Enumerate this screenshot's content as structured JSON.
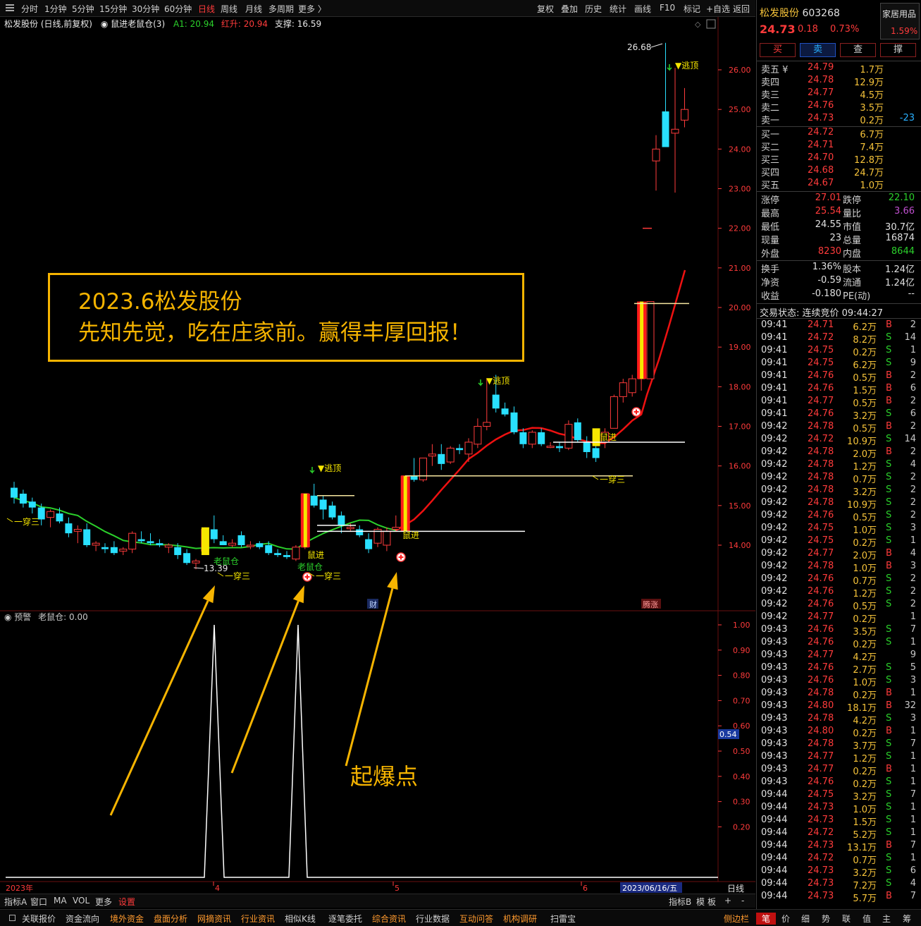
{
  "toolbar": {
    "periods": [
      "分时",
      "1分钟",
      "5分钟",
      "15分钟",
      "30分钟",
      "60分钟",
      "日线",
      "周线",
      "月线",
      "多周期",
      "更多 〉"
    ],
    "active_period": "日线",
    "tools": [
      "复权",
      "叠加",
      "历史",
      "统计",
      "画线",
      "F10",
      "标记",
      "+自选",
      "返回"
    ]
  },
  "chart_header": {
    "title": "松发股份 (日线,前复权)",
    "indicator": "鼠进老鼠仓(3)",
    "a1": "A1: 20.94",
    "hongsheng": "红升: 20.94",
    "support": "支撑: 16.59"
  },
  "annotation": {
    "line1": "2023.6松发股份",
    "line2": "先知先觉，吃在庄家前。赢得丰厚回报！",
    "boom": "起爆点"
  },
  "price_axis": [
    "26.00",
    "25.00",
    "24.00",
    "23.00",
    "22.00",
    "21.00",
    "20.00",
    "19.00",
    "18.00",
    "17.00",
    "16.00",
    "15.00",
    "14.00"
  ],
  "indicator_axis": [
    "1.00",
    "0.90",
    "0.80",
    "0.70",
    "0.60",
    "0.50",
    "0.40",
    "0.30",
    "0.20"
  ],
  "indicator_current": "0.54",
  "indicator_header": {
    "name": "预警",
    "value": "老鼠仓: 0.00"
  },
  "chart_labels": {
    "high": "26.68",
    "low": "13.39",
    "escape_top": "▼逃顶",
    "yichuansan": "一穿三",
    "laoshucang": "老鼠仓",
    "shujin": "鼠进",
    "cai": "财",
    "tengzhang": "腾涨"
  },
  "date_axis": {
    "year": "2023年",
    "months": [
      "4",
      "5",
      "6"
    ],
    "current_date": "2023/06/16/五",
    "period": "日线"
  },
  "bottom_tabs": {
    "left": [
      "指标A",
      "窗口",
      "MA",
      "VOL",
      "更多",
      "设置"
    ],
    "right": [
      "指标B",
      "模",
      "板",
      "+",
      "-"
    ]
  },
  "bottom_links": [
    "关联报价",
    "资金流向",
    "境外资金",
    "盘面分析",
    "网摘资讯",
    "行业资讯",
    "相似K线",
    "逐笔委托",
    "综合资讯",
    "行业数据",
    "互动问答",
    "机构调研",
    "扫雷宝",
    "侧边栏"
  ],
  "right_bottom_tabs": [
    "笔",
    "价",
    "细",
    "势",
    "联",
    "值",
    "主",
    "筹"
  ],
  "quote": {
    "name": "松发股份",
    "code": "603268",
    "price": "24.73",
    "change": "0.18",
    "pct": "0.73%",
    "sector_name": "家居用品",
    "sector_pct": "1.59%",
    "buttons": [
      "买",
      "卖",
      "查",
      "撑"
    ],
    "asks": [
      {
        "label": "卖五 ¥",
        "price": "24.79",
        "vol": "1.7万",
        "diff": ""
      },
      {
        "label": "卖四",
        "price": "24.78",
        "vol": "12.9万",
        "diff": ""
      },
      {
        "label": "卖三",
        "price": "24.77",
        "vol": "4.5万",
        "diff": ""
      },
      {
        "label": "卖二",
        "price": "24.76",
        "vol": "3.5万",
        "diff": ""
      },
      {
        "label": "卖一",
        "price": "24.73",
        "vol": "0.2万",
        "diff": "-23"
      }
    ],
    "bids": [
      {
        "label": "买一",
        "price": "24.72",
        "vol": "6.7万"
      },
      {
        "label": "买二",
        "price": "24.71",
        "vol": "7.4万"
      },
      {
        "label": "买三",
        "price": "24.70",
        "vol": "12.8万"
      },
      {
        "label": "买四",
        "price": "24.68",
        "vol": "24.7万"
      },
      {
        "label": "买五",
        "price": "24.67",
        "vol": "1.0万"
      }
    ],
    "stats": [
      {
        "k1": "涨停",
        "v1": "27.01",
        "c1": "#ff3b3b",
        "k2": "跌停",
        "v2": "22.10",
        "c2": "#2bd02b"
      },
      {
        "k1": "最高",
        "v1": "25.54",
        "c1": "#ff3b3b",
        "k2": "量比",
        "v2": "3.66",
        "c2": "#c050d0"
      },
      {
        "k1": "最低",
        "v1": "24.55",
        "c1": "#e0e0e0",
        "k2": "市值",
        "v2": "30.7亿",
        "c2": "#e0e0e0"
      },
      {
        "k1": "现量",
        "v1": "23",
        "c1": "#e0e0e0",
        "k2": "总量",
        "v2": "16874",
        "c2": "#e0e0e0"
      },
      {
        "k1": "外盘",
        "v1": "8230",
        "c1": "#ff3b3b",
        "k2": "内盘",
        "v2": "8644",
        "c2": "#2bd02b"
      },
      {
        "k1": "换手",
        "v1": "1.36%",
        "c1": "#e0e0e0",
        "k2": "股本",
        "v2": "1.24亿",
        "c2": "#e0e0e0"
      },
      {
        "k1": "净资",
        "v1": "-0.59",
        "c1": "#e0e0e0",
        "k2": "流通",
        "v2": "1.24亿",
        "c2": "#e0e0e0"
      },
      {
        "k1": "收益",
        "v1": "-0.180",
        "c1": "#e0e0e0",
        "k2": "PE(动)",
        "v2": "--",
        "c2": "#e0e0e0"
      }
    ],
    "trade_status": "交易状态: 连续竞价 09:44:27",
    "ticks": [
      [
        "09:41",
        "24.71",
        "6.2万",
        "B",
        "2"
      ],
      [
        "09:41",
        "24.72",
        "8.2万",
        "S",
        "14"
      ],
      [
        "09:41",
        "24.75",
        "0.2万",
        "S",
        "1"
      ],
      [
        "09:41",
        "24.75",
        "6.2万",
        "S",
        "9"
      ],
      [
        "09:41",
        "24.76",
        "0.5万",
        "B",
        "2"
      ],
      [
        "09:41",
        "24.76",
        "1.5万",
        "B",
        "6"
      ],
      [
        "09:41",
        "24.77",
        "0.5万",
        "B",
        "2"
      ],
      [
        "09:41",
        "24.76",
        "3.2万",
        "S",
        "6"
      ],
      [
        "09:42",
        "24.78",
        "0.5万",
        "B",
        "2"
      ],
      [
        "09:42",
        "24.72",
        "10.9万",
        "S",
        "14"
      ],
      [
        "09:42",
        "24.78",
        "2.0万",
        "B",
        "2"
      ],
      [
        "09:42",
        "24.78",
        "1.2万",
        "S",
        "4"
      ],
      [
        "09:42",
        "24.78",
        "0.7万",
        "S",
        "2"
      ],
      [
        "09:42",
        "24.78",
        "3.2万",
        "S",
        "2"
      ],
      [
        "09:42",
        "24.78",
        "10.9万",
        "S",
        "2"
      ],
      [
        "09:42",
        "24.76",
        "0.5万",
        "S",
        "2"
      ],
      [
        "09:42",
        "24.75",
        "1.0万",
        "S",
        "3"
      ],
      [
        "09:42",
        "24.75",
        "0.2万",
        "S",
        "1"
      ],
      [
        "09:42",
        "24.77",
        "2.0万",
        "B",
        "4"
      ],
      [
        "09:42",
        "24.78",
        "1.0万",
        "B",
        "3"
      ],
      [
        "09:42",
        "24.76",
        "0.7万",
        "S",
        "2"
      ],
      [
        "09:42",
        "24.76",
        "1.2万",
        "S",
        "2"
      ],
      [
        "09:42",
        "24.76",
        "0.5万",
        "S",
        "2"
      ],
      [
        "09:42",
        "24.77",
        "0.2万",
        "",
        "1"
      ],
      [
        "09:43",
        "24.76",
        "3.5万",
        "S",
        "7"
      ],
      [
        "09:43",
        "24.76",
        "0.2万",
        "S",
        "1"
      ],
      [
        "09:43",
        "24.77",
        "4.2万",
        "",
        "9"
      ],
      [
        "09:43",
        "24.76",
        "2.7万",
        "S",
        "5"
      ],
      [
        "09:43",
        "24.76",
        "1.0万",
        "S",
        "3"
      ],
      [
        "09:43",
        "24.78",
        "0.2万",
        "B",
        "1"
      ],
      [
        "09:43",
        "24.80",
        "18.1万",
        "B",
        "32"
      ],
      [
        "09:43",
        "24.78",
        "4.2万",
        "S",
        "3"
      ],
      [
        "09:43",
        "24.80",
        "0.2万",
        "B",
        "1"
      ],
      [
        "09:43",
        "24.78",
        "3.7万",
        "S",
        "7"
      ],
      [
        "09:43",
        "24.77",
        "1.2万",
        "S",
        "1"
      ],
      [
        "09:43",
        "24.77",
        "0.2万",
        "B",
        "1"
      ],
      [
        "09:43",
        "24.76",
        "0.2万",
        "S",
        "1"
      ],
      [
        "09:44",
        "24.75",
        "3.2万",
        "S",
        "7"
      ],
      [
        "09:44",
        "24.73",
        "1.0万",
        "S",
        "1"
      ],
      [
        "09:44",
        "24.73",
        "1.5万",
        "S",
        "1"
      ],
      [
        "09:44",
        "24.72",
        "5.2万",
        "S",
        "1"
      ],
      [
        "09:44",
        "24.73",
        "13.1万",
        "B",
        "7"
      ],
      [
        "09:44",
        "24.72",
        "0.7万",
        "S",
        "1"
      ],
      [
        "09:44",
        "24.73",
        "3.2万",
        "S",
        "6"
      ],
      [
        "09:44",
        "24.73",
        "7.2万",
        "S",
        "4"
      ],
      [
        "09:44",
        "24.73",
        "5.7万",
        "B",
        "7"
      ]
    ]
  },
  "colors": {
    "up": "#ff3b3b",
    "down": "#29e0ff",
    "ma_green": "#2bd02b",
    "ma_red": "#ee1111",
    "accent": "#f6b400",
    "laoshucang_bar": "#f6e600"
  },
  "chart_data": {
    "type": "candlestick",
    "price_range": [
      13.2,
      26.9
    ],
    "candles": [
      {
        "o": 15.45,
        "h": 15.6,
        "l": 15.05,
        "c": 15.2
      },
      {
        "o": 15.3,
        "h": 15.4,
        "l": 14.95,
        "c": 15.05
      },
      {
        "o": 15.1,
        "h": 15.2,
        "l": 14.8,
        "c": 14.95
      },
      {
        "o": 14.95,
        "h": 15.05,
        "l": 14.5,
        "c": 14.65
      },
      {
        "o": 14.7,
        "h": 14.9,
        "l": 14.45,
        "c": 14.85
      },
      {
        "o": 14.8,
        "h": 14.95,
        "l": 14.55,
        "c": 14.6
      },
      {
        "o": 14.55,
        "h": 14.7,
        "l": 14.2,
        "c": 14.3
      },
      {
        "o": 14.35,
        "h": 14.5,
        "l": 14.05,
        "c": 14.4
      },
      {
        "o": 14.4,
        "h": 14.55,
        "l": 13.95,
        "c": 14.0
      },
      {
        "o": 14.0,
        "h": 14.1,
        "l": 13.85,
        "c": 14.05
      },
      {
        "o": 13.95,
        "h": 14.05,
        "l": 13.8,
        "c": 13.9
      },
      {
        "o": 13.95,
        "h": 14.1,
        "l": 13.75,
        "c": 13.8
      },
      {
        "o": 13.85,
        "h": 13.95,
        "l": 13.75,
        "c": 13.9
      },
      {
        "o": 13.9,
        "h": 14.35,
        "l": 13.8,
        "c": 14.3
      },
      {
        "o": 14.15,
        "h": 14.35,
        "l": 14.05,
        "c": 14.1
      },
      {
        "o": 14.1,
        "h": 14.3,
        "l": 14.0,
        "c": 14.05
      },
      {
        "o": 14.05,
        "h": 14.15,
        "l": 13.95,
        "c": 14.0
      },
      {
        "o": 13.95,
        "h": 14.05,
        "l": 13.8,
        "c": 14.0
      },
      {
        "o": 13.95,
        "h": 14.05,
        "l": 13.65,
        "c": 13.75
      },
      {
        "o": 13.8,
        "h": 13.9,
        "l": 13.5,
        "c": 13.55
      },
      {
        "o": 13.55,
        "h": 13.65,
        "l": 13.39,
        "c": 13.6
      },
      {
        "o": 13.85,
        "h": 14.45,
        "l": 13.8,
        "c": 14.4
      },
      {
        "o": 14.4,
        "h": 14.75,
        "l": 14.05,
        "c": 14.15
      },
      {
        "o": 14.1,
        "h": 14.25,
        "l": 14.0,
        "c": 14.0
      },
      {
        "o": 14.0,
        "h": 14.15,
        "l": 13.95,
        "c": 14.05
      },
      {
        "o": 14.25,
        "h": 14.35,
        "l": 13.95,
        "c": 14.0
      },
      {
        "o": 14.0,
        "h": 14.1,
        "l": 13.9,
        "c": 14.0
      },
      {
        "o": 14.05,
        "h": 14.1,
        "l": 13.9,
        "c": 13.95
      },
      {
        "o": 14.0,
        "h": 14.1,
        "l": 13.75,
        "c": 13.8
      },
      {
        "o": 13.8,
        "h": 13.9,
        "l": 13.7,
        "c": 13.75
      },
      {
        "o": 13.75,
        "h": 13.85,
        "l": 13.65,
        "c": 13.7
      },
      {
        "o": 13.65,
        "h": 14.0,
        "l": 13.6,
        "c": 13.95
      },
      {
        "o": 13.95,
        "h": 15.3,
        "l": 13.9,
        "c": 15.3
      },
      {
        "o": 15.25,
        "h": 15.55,
        "l": 14.95,
        "c": 15.0
      },
      {
        "o": 15.15,
        "h": 15.25,
        "l": 14.65,
        "c": 14.9
      },
      {
        "o": 15.0,
        "h": 15.1,
        "l": 14.65,
        "c": 14.7
      },
      {
        "o": 14.75,
        "h": 14.85,
        "l": 14.3,
        "c": 14.5
      },
      {
        "o": 14.45,
        "h": 14.55,
        "l": 14.35,
        "c": 14.45
      },
      {
        "o": 14.4,
        "h": 14.5,
        "l": 14.2,
        "c": 14.25
      },
      {
        "o": 14.15,
        "h": 14.3,
        "l": 13.8,
        "c": 13.9
      },
      {
        "o": 14.05,
        "h": 14.45,
        "l": 13.95,
        "c": 14.4
      },
      {
        "o": 14.0,
        "h": 14.45,
        "l": 13.85,
        "c": 14.35
      },
      {
        "o": 14.4,
        "h": 14.75,
        "l": 14.35,
        "c": 14.45
      },
      {
        "o": 14.35,
        "h": 15.75,
        "l": 14.35,
        "c": 15.75
      },
      {
        "o": 15.75,
        "h": 16.2,
        "l": 15.6,
        "c": 15.65
      },
      {
        "o": 15.65,
        "h": 16.2,
        "l": 15.6,
        "c": 16.2
      },
      {
        "o": 16.25,
        "h": 16.55,
        "l": 16.0,
        "c": 16.3
      },
      {
        "o": 16.3,
        "h": 16.55,
        "l": 15.9,
        "c": 16.05
      },
      {
        "o": 16.1,
        "h": 16.5,
        "l": 16.05,
        "c": 16.45
      },
      {
        "o": 16.45,
        "h": 16.55,
        "l": 16.3,
        "c": 16.4
      },
      {
        "o": 16.3,
        "h": 16.7,
        "l": 16.1,
        "c": 16.6
      },
      {
        "o": 16.55,
        "h": 17.2,
        "l": 16.45,
        "c": 17.0
      },
      {
        "o": 17.0,
        "h": 18.2,
        "l": 16.9,
        "c": 17.1
      },
      {
        "o": 17.8,
        "h": 18.3,
        "l": 17.35,
        "c": 17.45
      },
      {
        "o": 17.45,
        "h": 17.6,
        "l": 17.25,
        "c": 17.3
      },
      {
        "o": 17.35,
        "h": 17.5,
        "l": 16.8,
        "c": 16.85
      },
      {
        "o": 16.85,
        "h": 16.95,
        "l": 16.45,
        "c": 16.55
      },
      {
        "o": 16.55,
        "h": 16.9,
        "l": 16.45,
        "c": 16.85
      },
      {
        "o": 16.85,
        "h": 16.95,
        "l": 16.5,
        "c": 16.55
      },
      {
        "o": 16.5,
        "h": 16.6,
        "l": 16.45,
        "c": 16.5
      },
      {
        "o": 16.5,
        "h": 16.6,
        "l": 16.35,
        "c": 16.45
      },
      {
        "o": 16.45,
        "h": 17.15,
        "l": 16.4,
        "c": 17.05
      },
      {
        "o": 17.1,
        "h": 17.2,
        "l": 16.6,
        "c": 16.65
      },
      {
        "o": 16.6,
        "h": 16.75,
        "l": 16.2,
        "c": 16.35
      },
      {
        "o": 16.45,
        "h": 16.6,
        "l": 16.1,
        "c": 16.2
      },
      {
        "o": 16.6,
        "h": 16.95,
        "l": 16.45,
        "c": 16.85
      },
      {
        "o": 16.95,
        "h": 17.8,
        "l": 16.95,
        "c": 17.75
      },
      {
        "o": 17.75,
        "h": 18.2,
        "l": 17.6,
        "c": 18.1
      },
      {
        "o": 17.85,
        "h": 18.3,
        "l": 17.75,
        "c": 18.2
      },
      {
        "o": 18.2,
        "h": 18.8,
        "l": 17.9,
        "c": 18.3
      },
      {
        "o": 18.2,
        "h": 20.15,
        "l": 18.2,
        "c": 20.15
      },
      {
        "o": 23.7,
        "h": 24.35,
        "l": 22.95,
        "c": 24.0
      },
      {
        "o": 24.95,
        "h": 26.68,
        "l": 24.05,
        "c": 24.05
      },
      {
        "o": 24.4,
        "h": 26.05,
        "l": 22.9,
        "c": 24.5
      },
      {
        "o": 24.73,
        "h": 25.54,
        "l": 24.55,
        "c": 25.0
      }
    ]
  }
}
